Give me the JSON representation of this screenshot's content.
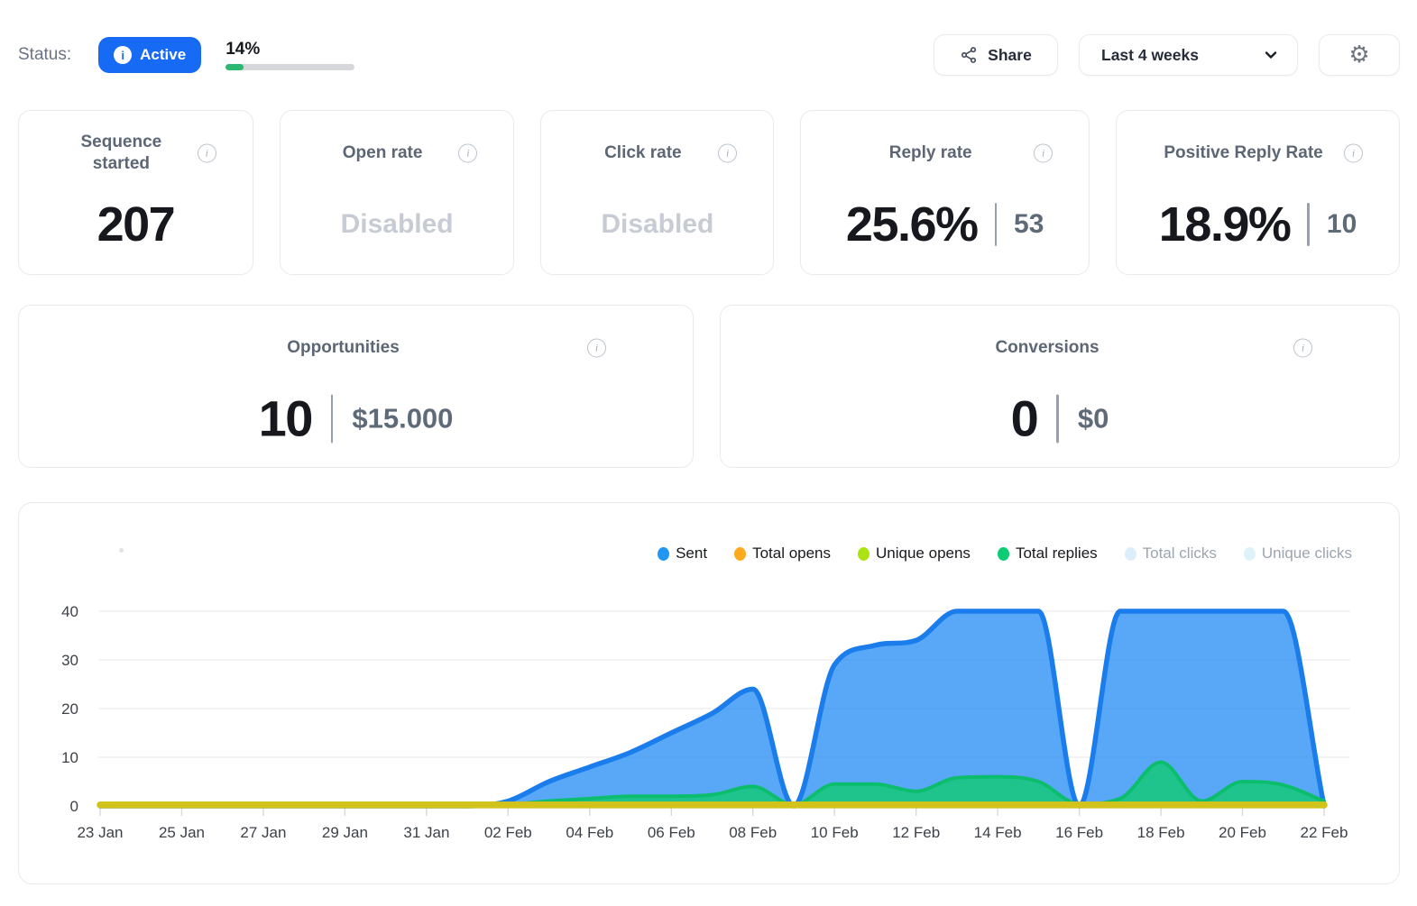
{
  "header": {
    "status_label": "Status:",
    "status_value": "Active",
    "progress_percent": "14%",
    "progress_fraction": 14,
    "share_label": "Share",
    "range_selector": "Last 4 weeks"
  },
  "stat_cards": [
    {
      "title": "Sequence\nstarted",
      "value": "207"
    },
    {
      "title": "Open rate",
      "disabled_text": "Disabled"
    },
    {
      "title": "Click rate",
      "disabled_text": "Disabled"
    },
    {
      "title": "Reply rate",
      "value": "25.6%",
      "secondary": "53"
    },
    {
      "title": "Positive Reply Rate",
      "value": "18.9%",
      "secondary": "10"
    }
  ],
  "wide_cards": [
    {
      "title": "Opportunities",
      "value": "10",
      "secondary": "$15.000"
    },
    {
      "title": "Conversions",
      "value": "0",
      "secondary": "$0"
    }
  ],
  "chart_data": {
    "type": "area",
    "x": [
      "23 Jan",
      "24 Jan",
      "25 Jan",
      "26 Jan",
      "27 Jan",
      "28 Jan",
      "29 Jan",
      "30 Jan",
      "31 Jan",
      "01 Feb",
      "02 Feb",
      "03 Feb",
      "04 Feb",
      "05 Feb",
      "06 Feb",
      "07 Feb",
      "08 Feb",
      "09 Feb",
      "10 Feb",
      "11 Feb",
      "12 Feb",
      "13 Feb",
      "14 Feb",
      "15 Feb",
      "16 Feb",
      "17 Feb",
      "18 Feb",
      "19 Feb",
      "20 Feb",
      "21 Feb",
      "22 Feb"
    ],
    "x_tick_step": 2,
    "yticks": [
      0,
      10,
      20,
      30,
      40
    ],
    "ylim": [
      0,
      44
    ],
    "grid": "horizontal",
    "legend_position": "top-right",
    "series": [
      {
        "name": "Sent",
        "color": "#1b7deb",
        "legend_color": "#2196f3",
        "fill": "rgba(33,139,244,0.75)",
        "line_width": 5.5,
        "values": [
          0,
          0,
          0,
          0,
          0,
          0,
          0,
          0,
          0,
          0,
          1,
          5,
          8,
          11,
          15,
          19,
          24,
          0,
          29,
          33,
          34,
          40,
          40,
          40,
          0,
          40,
          40,
          40,
          40,
          40,
          0
        ]
      },
      {
        "name": "Total opens",
        "color": "#f2a922",
        "legend_color": "#fbab1d",
        "line_width": 7.5,
        "values": [
          0.2,
          0.2,
          0.2,
          0.2,
          0.2,
          0.2,
          0.2,
          0.2,
          0.2,
          0.2,
          0.2,
          0.2,
          0.2,
          0.2,
          0.2,
          0.2,
          0.2,
          0.2,
          0.2,
          0.2,
          0.2,
          0.2,
          0.2,
          0.2,
          0.2,
          0.2,
          0.2,
          0.2,
          0.2,
          0.2,
          0.2
        ]
      },
      {
        "name": "Unique opens",
        "color": "#abe313",
        "legend_color": "#abe313",
        "line_width": 7.5,
        "line_opacity": 0.45,
        "values": [
          0.2,
          0.2,
          0.2,
          0.2,
          0.2,
          0.2,
          0.2,
          0.2,
          0.2,
          0.2,
          0.2,
          0.2,
          0.2,
          0.2,
          0.2,
          0.2,
          0.2,
          0.2,
          0.2,
          0.2,
          0.2,
          0.2,
          0.2,
          0.2,
          0.2,
          0.2,
          0.2,
          0.2,
          0.2,
          0.2,
          0.2
        ]
      },
      {
        "name": "Total replies",
        "color": "#0dbd6e",
        "legend_color": "#0ccc74",
        "fill": "rgba(16,202,112,0.8)",
        "line_width": 4,
        "values": [
          0,
          0,
          0,
          0,
          0,
          0,
          0,
          0,
          0,
          0,
          0.3,
          1,
          1.5,
          2,
          2,
          2.3,
          4,
          0.2,
          4.5,
          4.5,
          3,
          5.8,
          6,
          5,
          0.4,
          1.5,
          9,
          1,
          5,
          4.3,
          1
        ]
      },
      {
        "name": "Total clicks",
        "color": "#ddeefb",
        "legend_color": "#ddeefb",
        "disabled": true,
        "values": []
      },
      {
        "name": "Unique clicks",
        "color": "#def3f9",
        "legend_color": "#def3f9",
        "disabled": true,
        "values": []
      }
    ]
  }
}
